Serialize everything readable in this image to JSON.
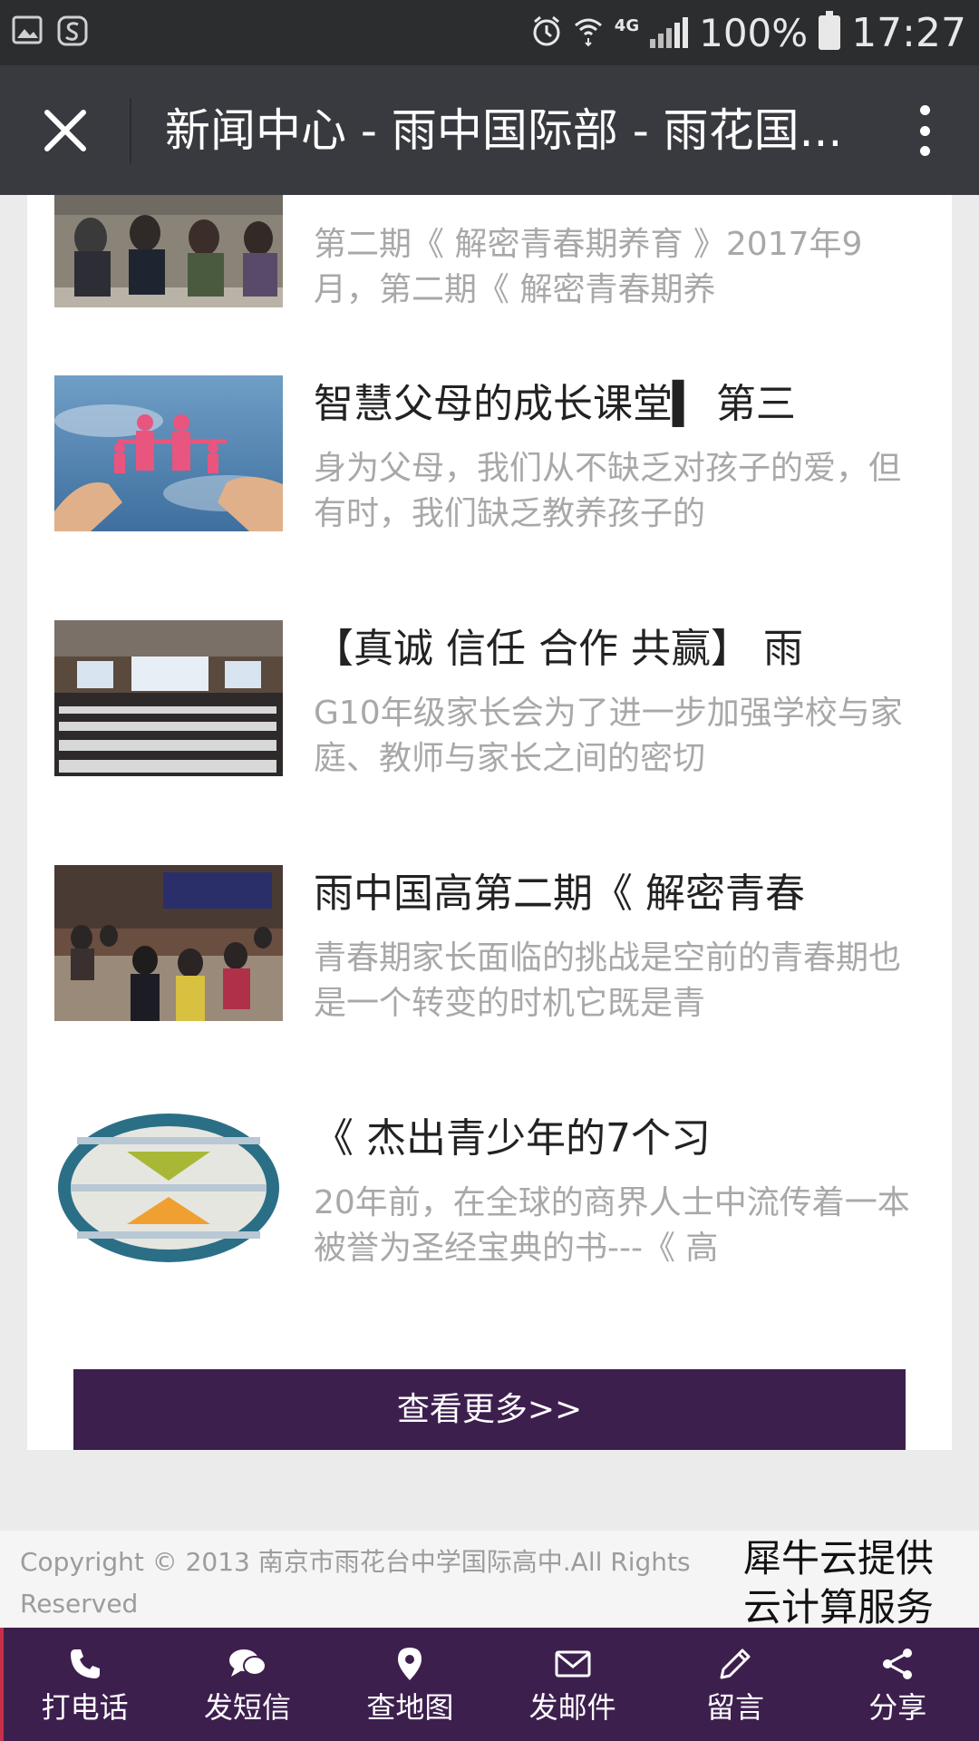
{
  "status_bar": {
    "left_icons": [
      "image-icon",
      "sogou-icon"
    ],
    "network": "4G",
    "battery": "100%",
    "time": "17:27"
  },
  "nav": {
    "title": "新闻中心 - 雨中国际部 - 雨花国..."
  },
  "articles": [
    {
      "title": "",
      "desc": "第二期《 解密青春期养育 》2017年9月，第二期《 解密青春期养"
    },
    {
      "title": "智慧父母的成长课堂▍ 第三",
      "desc": "身为父母，我们从不缺乏对孩子的爱，但有时，我们缺乏教养孩子的"
    },
    {
      "title": "【真诚 信任 合作 共赢】 雨",
      "desc": "G10年级家长会为了进一步加强学校与家庭、教师与家长之间的密切"
    },
    {
      "title": "雨中国高第二期《 解密青春",
      "desc": "青春期家长面临的挑战是空前的青春期也是一个转变的时机它既是青"
    },
    {
      "title": "《 杰出青少年的7个习",
      "desc": "20年前，在全球的商界人士中流传着一本被誉为圣经宝典的书---《 高"
    }
  ],
  "more_button": "查看更多>>",
  "footer": {
    "copyright": "Copyright © 2013 南京市雨花台中学国际高中.All Rights Reserved",
    "badge": "犀牛云提供云计算服务"
  },
  "bottom_tabs": [
    {
      "label": "打电话",
      "icon": "phone-icon"
    },
    {
      "label": "发短信",
      "icon": "chat-icon"
    },
    {
      "label": "查地图",
      "icon": "map-pin-icon"
    },
    {
      "label": "发邮件",
      "icon": "mail-icon"
    },
    {
      "label": "留言",
      "icon": "pencil-icon"
    },
    {
      "label": "分享",
      "icon": "share-icon"
    }
  ],
  "colors": {
    "accent": "#3d1f4e",
    "navbar": "#393a3f",
    "statusbar": "#2b2d2f"
  }
}
